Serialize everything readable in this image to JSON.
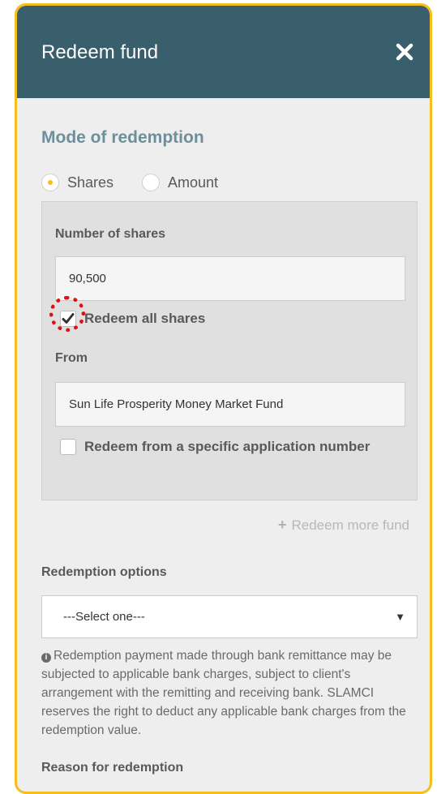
{
  "header": {
    "title": "Redeem fund"
  },
  "mode": {
    "title": "Mode of redemption",
    "options": [
      "Shares",
      "Amount"
    ],
    "selected": "Shares"
  },
  "shares_section": {
    "number_label": "Number of shares",
    "number_value": "90,500",
    "redeem_all_label": "Redeem all shares",
    "redeem_all_checked": true,
    "from_label": "From",
    "from_value": "Sun Life Prosperity Money Market Fund",
    "specific_app_label": "Redeem from a specific application number",
    "specific_app_checked": false
  },
  "redeem_more": {
    "label": "Redeem more fund"
  },
  "redemption_options": {
    "label": "Redemption options",
    "selected": "---Select one---"
  },
  "note": "Redemption payment made through bank remittance may be subjected to applicable bank charges, subject to client's arrangement with the remitting and receiving bank. SLAMCI reserves the right to deduct any applicable bank charges from the redemption value.",
  "reason": {
    "label": "Reason for redemption"
  },
  "colors": {
    "header_bg": "#385f6b",
    "accent_border": "#f5bf1b",
    "section_title": "#6d8f9b",
    "highlight": "#e01010"
  }
}
